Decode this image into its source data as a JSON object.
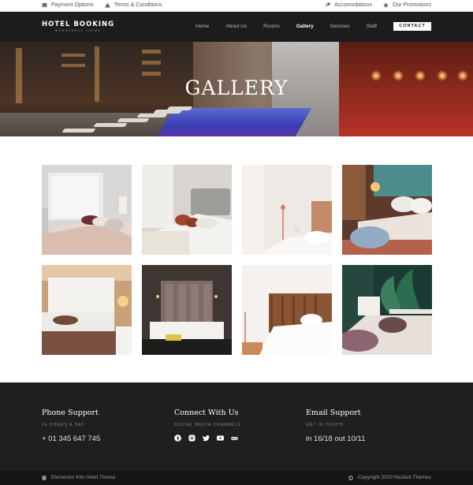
{
  "topbar": {
    "left": [
      {
        "icon": "laptop-icon",
        "label": "Payment Options"
      },
      {
        "icon": "warning-icon",
        "label": "Terms & Conditions"
      }
    ],
    "right": [
      {
        "icon": "key-icon",
        "label": "Accomodations"
      },
      {
        "icon": "star-icon",
        "label": "Our Promotions"
      }
    ]
  },
  "header": {
    "logo_title": "HOTEL BOOKING",
    "logo_subtitle": "WORDPRESS THEME",
    "menu": [
      "Home",
      "About Us",
      "Rooms",
      "Gallery",
      "Services",
      "Staff"
    ],
    "active": "Gallery",
    "cta_label": "CONTACT"
  },
  "hero": {
    "title": "GALLERY"
  },
  "gallery": {
    "images": [
      {
        "icon": "bedroom-photo-1"
      },
      {
        "icon": "bedroom-photo-2"
      },
      {
        "icon": "bedroom-photo-3"
      },
      {
        "icon": "bedroom-photo-4"
      },
      {
        "icon": "bedroom-photo-5"
      },
      {
        "icon": "bedroom-photo-6"
      },
      {
        "icon": "bedroom-photo-7"
      },
      {
        "icon": "bedroom-photo-8"
      }
    ]
  },
  "footer": {
    "phone": {
      "title": "Phone Support",
      "sub": "24 HOURS A DAY",
      "value": "+ 01 345 647 745"
    },
    "connect": {
      "title": "Connect With Us",
      "sub": "SOCIAL MEDIA CHANNELS",
      "icons": [
        "facebook-icon",
        "instagram-icon",
        "twitter-icon",
        "youtube-icon",
        "tripadvisor-icon"
      ]
    },
    "email": {
      "title": "Email Support",
      "sub": "GET IN TOUCH",
      "value": "in 16/18 out 10/11"
    }
  },
  "bottombar": {
    "left": "Elementor Kits Hotel Theme",
    "right": "Copyright 2020 Nicdark Themes"
  },
  "colors": {
    "nav_bg": "#1c1c1c",
    "footer_bg": "#1f1f1f",
    "bottom_bg": "#151515"
  }
}
